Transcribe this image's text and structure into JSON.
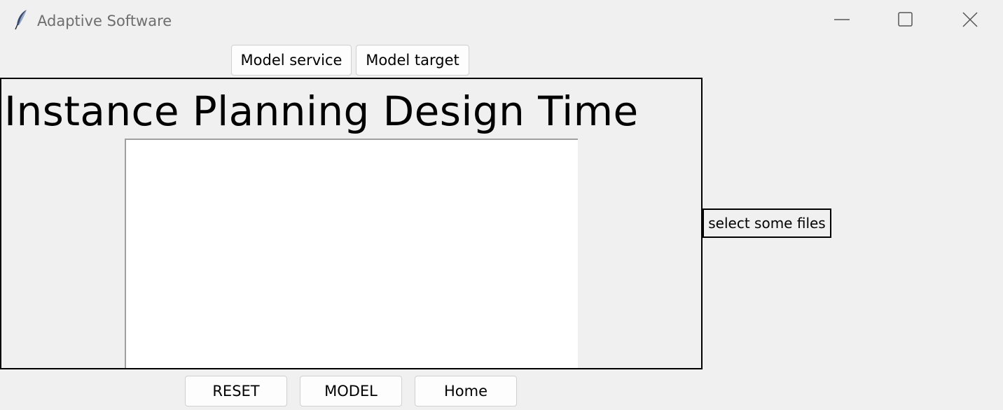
{
  "window": {
    "title": "Adaptive Software",
    "icon": "feather-icon",
    "controls": {
      "minimize_icon": "minimize-icon",
      "maximize_icon": "maximize-icon",
      "close_icon": "close-icon"
    }
  },
  "toolbar": {
    "model_service_label": "Model service",
    "model_target_label": "Model target"
  },
  "main": {
    "heading": "Instance Planning Design Time"
  },
  "side": {
    "files_label": "select some files"
  },
  "footer": {
    "reset_label": "RESET",
    "model_label": "MODEL",
    "home_label": "Home"
  },
  "colors": {
    "background": "#f0f0f0",
    "canvas": "#ffffff",
    "border": "#000000"
  }
}
